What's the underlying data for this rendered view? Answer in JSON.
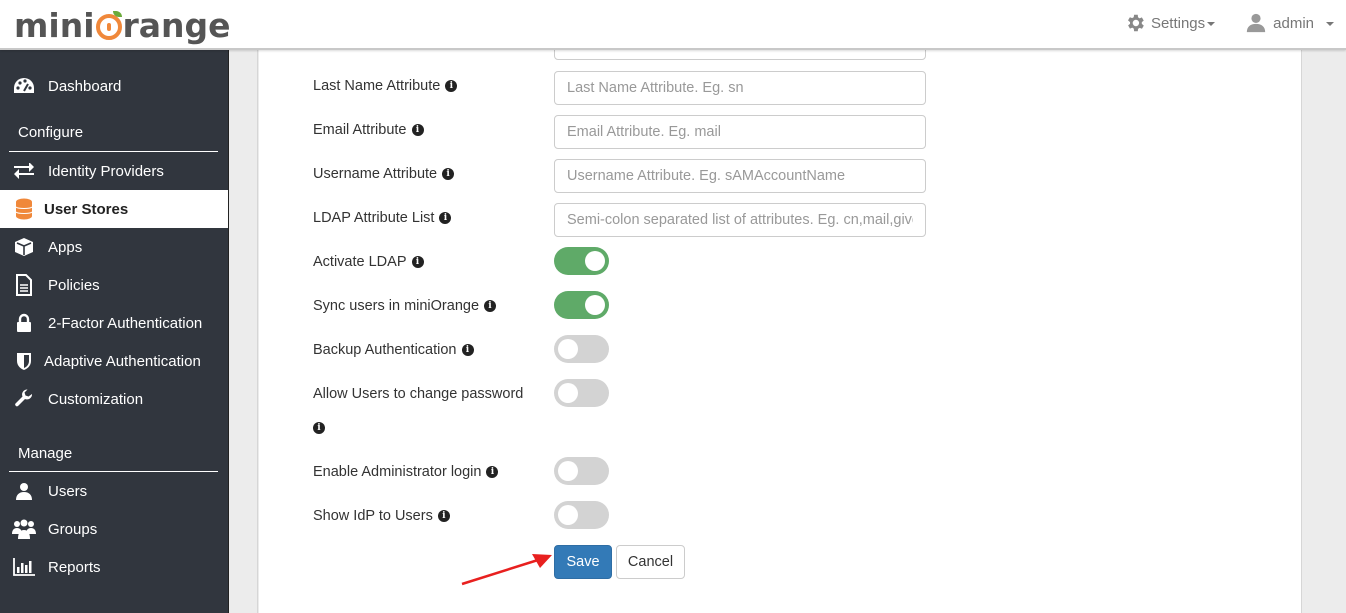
{
  "header": {
    "logo_text_left": "mini",
    "logo_text_right": "range",
    "settings_label": "Settings",
    "user_label": "admin",
    "settings_icon": "gear-icon",
    "user_icon": "user-icon"
  },
  "sidebar": {
    "items": [
      {
        "label": "Dashboard",
        "icon": "dashboard-icon"
      },
      {
        "label": "Identity Providers",
        "icon": "exchange-icon"
      },
      {
        "label": "User Stores",
        "icon": "database-icon",
        "active": true
      },
      {
        "label": "Apps",
        "icon": "cube-icon"
      },
      {
        "label": "Policies",
        "icon": "document-icon"
      },
      {
        "label": "2-Factor Authentication",
        "icon": "lock-icon"
      },
      {
        "label": "Adaptive Authentication",
        "icon": "shield-icon"
      },
      {
        "label": "Customization",
        "icon": "wrench-icon"
      },
      {
        "label": "Users",
        "icon": "user-icon"
      },
      {
        "label": "Groups",
        "icon": "group-icon"
      },
      {
        "label": "Reports",
        "icon": "bar-chart-icon"
      }
    ],
    "sections": {
      "configure": "Configure",
      "manage": "Manage"
    }
  },
  "form": {
    "fields": [
      {
        "label": "Last Name Attribute",
        "placeholder": "Last Name Attribute. Eg. sn",
        "value": ""
      },
      {
        "label": "Email Attribute",
        "placeholder": "Email Attribute. Eg. mail",
        "value": ""
      },
      {
        "label": "Username Attribute",
        "placeholder": "Username Attribute. Eg. sAMAccountName",
        "value": ""
      },
      {
        "label": "LDAP Attribute List",
        "placeholder": "Semi-colon separated list of attributes. Eg. cn,mail,givenName",
        "value": ""
      }
    ],
    "toggles": [
      {
        "label": "Activate LDAP",
        "on": true
      },
      {
        "label": "Sync users in miniOrange",
        "on": true
      },
      {
        "label": "Backup Authentication",
        "on": false
      },
      {
        "label": "Allow Users to change password",
        "on": false
      },
      {
        "label": "Enable Administrator login",
        "on": false
      },
      {
        "label": "Show IdP to Users",
        "on": false
      }
    ],
    "save_label": "Save",
    "cancel_label": "Cancel"
  },
  "colors": {
    "sidebar_bg": "#31363e",
    "accent_orange": "#f0883a",
    "toggle_on": "#5faa68",
    "toggle_off": "#d3d3d3",
    "primary_button": "#337ab7",
    "annotation_arrow": "#e8201f"
  }
}
